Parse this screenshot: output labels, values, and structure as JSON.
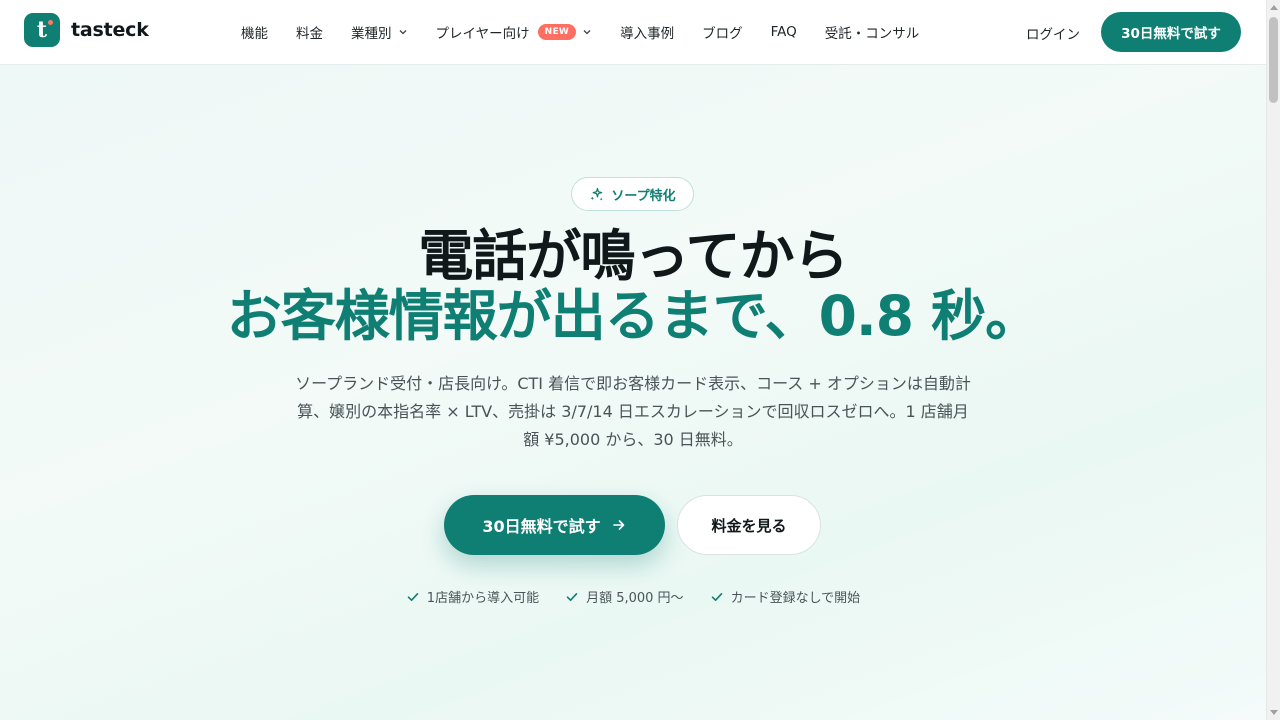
{
  "brand": {
    "name": "tasteck",
    "logo_letter": "t",
    "primary_color": "#0f7f73",
    "accent_dot_color": "#ff7a66"
  },
  "nav": {
    "items": [
      {
        "label": "機能",
        "has_dropdown": false
      },
      {
        "label": "料金",
        "has_dropdown": false
      },
      {
        "label": "業種別",
        "has_dropdown": true
      },
      {
        "label": "プレイヤー向け",
        "has_dropdown": true,
        "badge": "NEW"
      },
      {
        "label": "導入事例",
        "has_dropdown": false
      },
      {
        "label": "ブログ",
        "has_dropdown": false
      },
      {
        "label": "FAQ",
        "has_dropdown": false
      },
      {
        "label": "受託・コンサル",
        "has_dropdown": false
      }
    ],
    "login_label": "ログイン",
    "cta_label": "30日無料で試す",
    "badge_color": "#ff6f61"
  },
  "hero": {
    "tag": "ソープ特化",
    "headline_line1": "電話が鳴ってから",
    "headline_line2": "お客様情報が出るまで、0.8 秒。",
    "description": "ソープランド受付・店長向け。CTI 着信で即お客様カード表示、コース + オプションは自動計算、嬢別の本指名率 × LTV、売掛は 3/7/14 日エスカレーションで回収ロスゼロへ。1 店舗月額 ¥5,000 から、30 日無料。",
    "primary_button": "30日無料で試す",
    "secondary_button": "料金を見る",
    "features": [
      "1店舗から導入可能",
      "月額 5,000 円〜",
      "カード登録なしで開始"
    ]
  }
}
